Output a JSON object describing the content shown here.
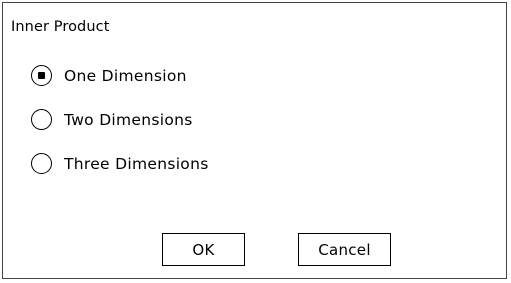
{
  "dialog": {
    "title": "Inner Product",
    "options": [
      {
        "label": "One Dimension",
        "selected": true
      },
      {
        "label": "Two Dimensions",
        "selected": false
      },
      {
        "label": "Three Dimensions",
        "selected": false
      }
    ],
    "ok_label": "OK",
    "cancel_label": "Cancel"
  }
}
